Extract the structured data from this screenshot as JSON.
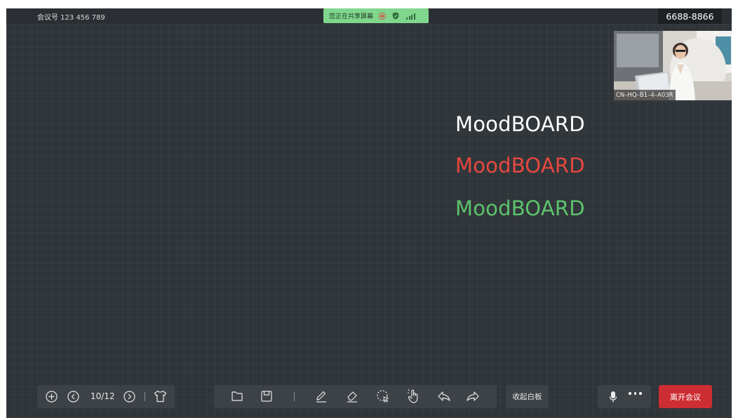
{
  "topbar": {
    "meeting_id": "会议号 123 456 789",
    "share_status": "您正在共享屏幕",
    "room_number": "6688-8866"
  },
  "video": {
    "participant_label": "CN–HQ–B1–4–A03R"
  },
  "whiteboard": {
    "texts": [
      {
        "text": "MoodBOARD",
        "color": "#ffffff"
      },
      {
        "text": "MoodBOARD",
        "color": "#e5483f"
      },
      {
        "text": "MoodBOARD",
        "color": "#5cc36b"
      }
    ]
  },
  "page_controls": {
    "page_indicator": "10/12",
    "icons": [
      "add-page-icon",
      "prev-page-icon",
      "next-page-icon",
      "background-icon"
    ]
  },
  "tools": {
    "icons": [
      "open-file-icon",
      "save-icon",
      "pen-icon",
      "eraser-icon",
      "lasso-select-icon",
      "hand-icon",
      "undo-icon",
      "redo-icon"
    ]
  },
  "actions": {
    "collapse_whiteboard": "收起白板",
    "leave_meeting": "离开会议",
    "icons": [
      "microphone-icon",
      "more-icon"
    ]
  },
  "colors": {
    "canvas": "#30353a",
    "share_pill": "#7fd68c",
    "leave_button": "#cc2e33"
  }
}
